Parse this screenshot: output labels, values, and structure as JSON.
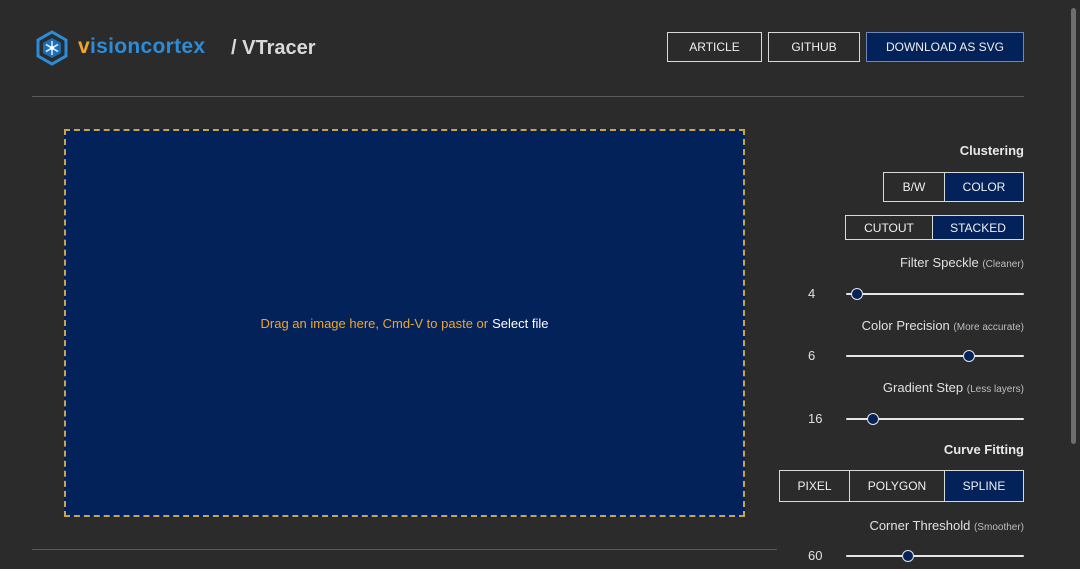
{
  "header": {
    "brand_v": "v",
    "brand_rest": "isioncortex",
    "subtitle": "/ VTracer",
    "article_label": "ARTICLE",
    "github_label": "GITHUB",
    "download_label": "DOWNLOAD AS SVG"
  },
  "dropzone": {
    "hint": "Drag an image here, Cmd-V to paste or",
    "select_file": "Select file"
  },
  "panel": {
    "clustering_title": "Clustering",
    "mode_options": [
      "B/W",
      "COLOR"
    ],
    "mode_selected": "COLOR",
    "hierarchy_options": [
      "CUTOUT",
      "STACKED"
    ],
    "hierarchy_selected": "STACKED",
    "filter_speckle": {
      "label": "Filter Speckle",
      "note": "(Cleaner)",
      "value": "4",
      "fraction": 0.06
    },
    "color_precision": {
      "label": "Color Precision",
      "note": "(More accurate)",
      "value": "6",
      "fraction": 0.69
    },
    "gradient_step": {
      "label": "Gradient Step",
      "note": "(Less layers)",
      "value": "16",
      "fraction": 0.15
    },
    "curve_fitting_title": "Curve Fitting",
    "curve_options": [
      "PIXEL",
      "POLYGON",
      "SPLINE"
    ],
    "curve_selected": "SPLINE",
    "corner_threshold": {
      "label": "Corner Threshold",
      "note": "(Smoother)",
      "value": "60",
      "fraction": 0.35
    }
  },
  "colors": {
    "accent_blue": "#2d8cd8",
    "accent_orange": "#f0a52c",
    "selected_bg": "#04225a",
    "dropzone_bg": "#03225a"
  }
}
